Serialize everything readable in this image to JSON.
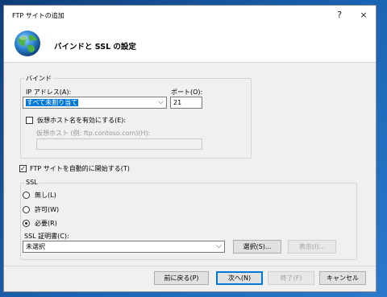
{
  "window": {
    "title": "FTP サイトの追加",
    "help_glyph": "?",
    "close_glyph": "×"
  },
  "header": {
    "title": "バインドと SSL の設定"
  },
  "binding": {
    "group_label": "バインド",
    "ip_label": "IP アドレス(A):",
    "ip_value": "すべて未割り当て",
    "port_label": "ポート(O):",
    "port_value": "21",
    "virtual_host_checkbox_label": "仮想ホスト名を有効にする(E):",
    "virtual_host_checked": false,
    "virtual_host_label": "仮想ホスト (例: ftp.contoso.com)(H):",
    "virtual_host_value": ""
  },
  "autostart": {
    "label": "FTP サイトを自動的に開始する(T)",
    "checked": true,
    "check_glyph": "✓"
  },
  "ssl": {
    "group_label": "SSL",
    "options": [
      {
        "label": "無し(L)",
        "selected": false
      },
      {
        "label": "許可(W)",
        "selected": false
      },
      {
        "label": "必要(R)",
        "selected": true
      }
    ],
    "cert_label": "SSL 証明書(C):",
    "cert_value": "未選択",
    "select_button": "選択(S)...",
    "view_button": "表示(I)..."
  },
  "footer": {
    "prev_button": "前に戻る(P)",
    "next_button": "次へ(N)",
    "finish_button": "終了(F)",
    "cancel_button": "キャンセル"
  },
  "icons": {
    "header_icon": "globe-icon",
    "dropdown_icon": "chevron-down-icon"
  },
  "colors": {
    "accent": "#0078d7",
    "dialog_bg": "#f0f0f0"
  }
}
